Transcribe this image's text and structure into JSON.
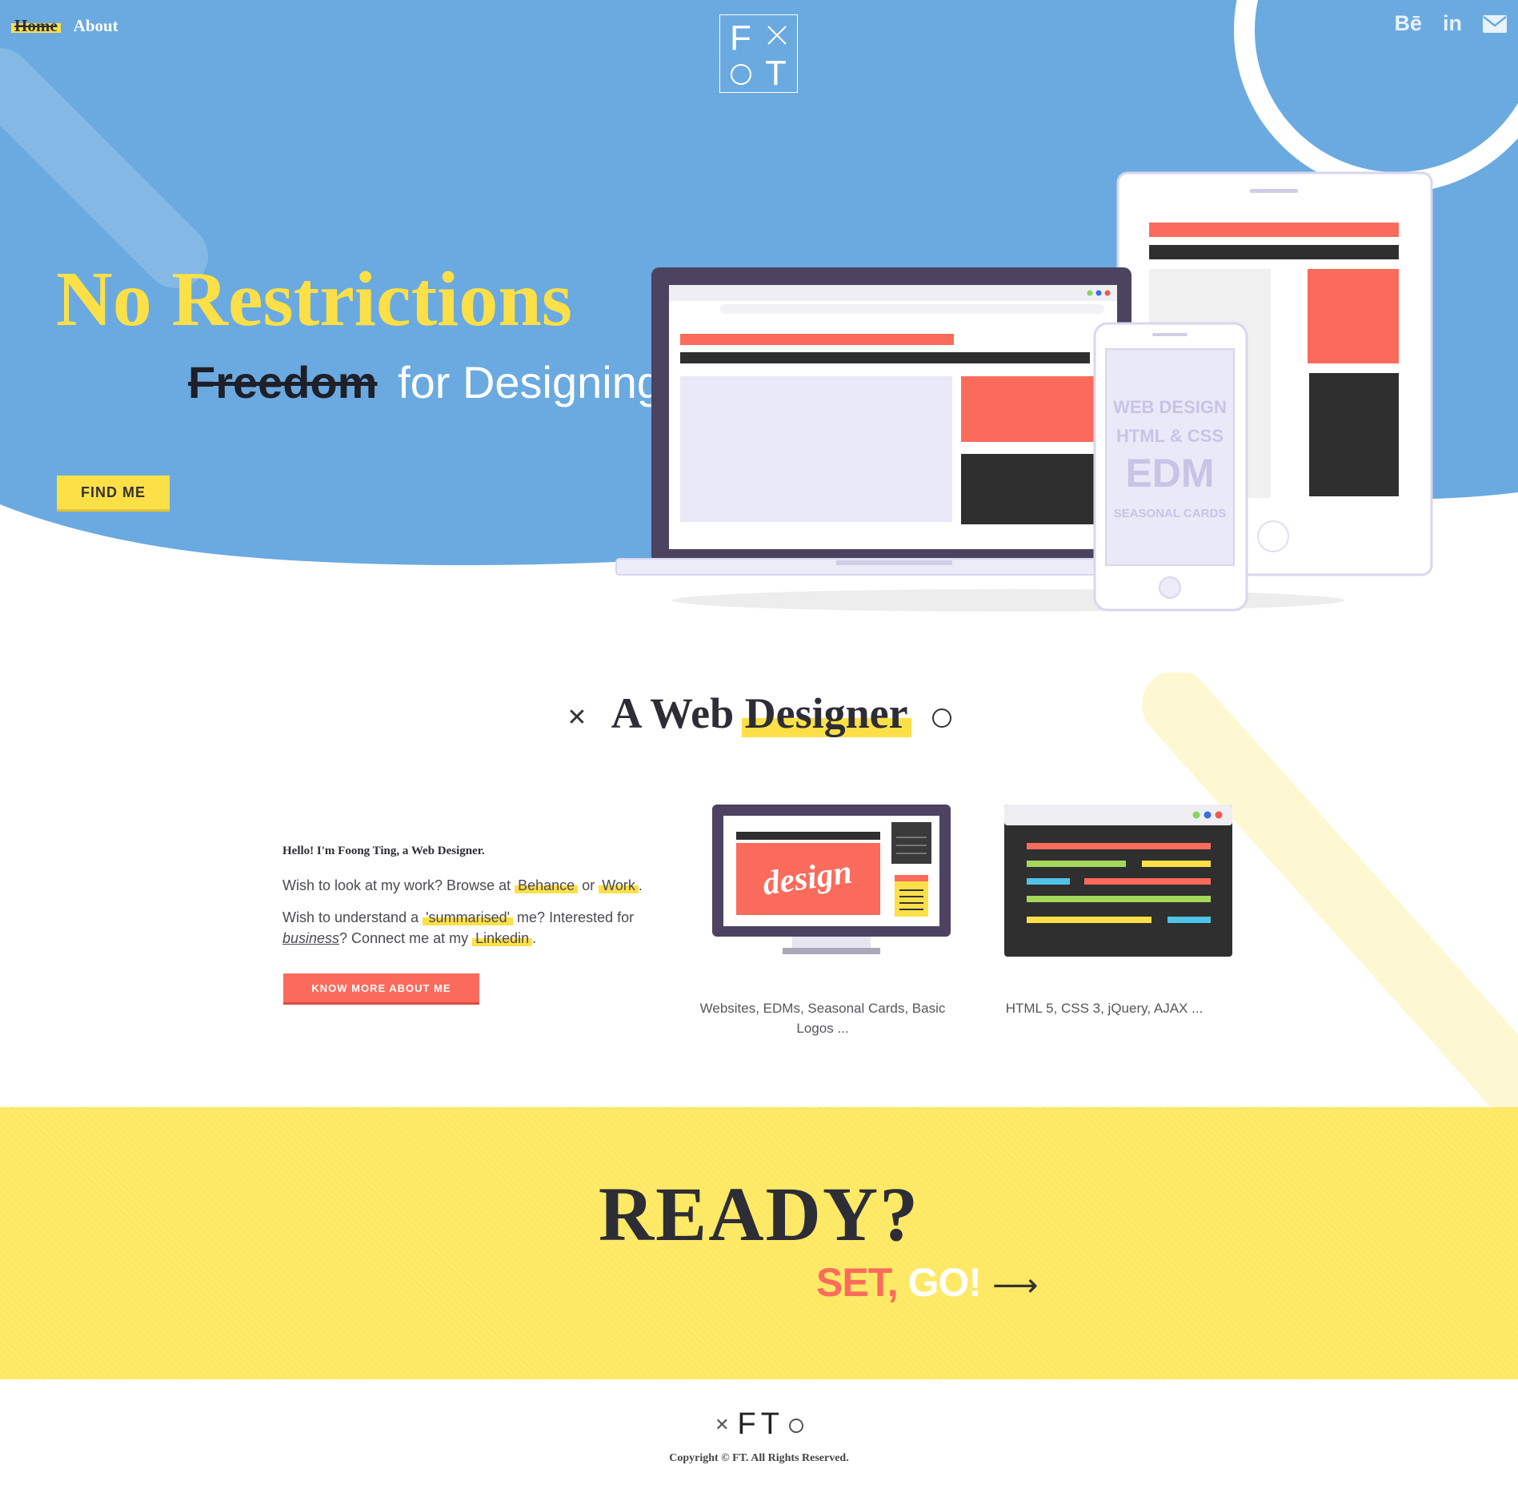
{
  "nav": {
    "home": "Home",
    "about": "About"
  },
  "logo": {
    "f": "F",
    "t": "T"
  },
  "social": {
    "behance": "Bē",
    "linkedin": "in",
    "mail_icon": "mail-icon"
  },
  "hero": {
    "title": "No Restrictions",
    "highlight": "Freedom",
    "subtitle_rest": "for Designing",
    "button": "FIND ME"
  },
  "mockups": {
    "phone_line1": "WEB DESIGN",
    "phone_line2": "HTML & CSS",
    "phone_line3": "EDM",
    "phone_line4": "SEASONAL CARDS",
    "design_word": "design"
  },
  "designer": {
    "title_start": "A Web",
    "title_highlight": "Designer",
    "hello": "Hello! I'm Foong Ting, a Web Designer.",
    "line1_pre": "Wish to look at my work? Browse at",
    "behance": "Behance",
    "or": "or",
    "work": "Work",
    "line1_end": ".",
    "line2_pre": "Wish to understand a",
    "summarised": "'summarised'",
    "line2_mid": "me? Interested for",
    "business": "business",
    "line2_mid2": "? Connect me at my",
    "linkedin": "Linkedin",
    "line2_end": ".",
    "button": "KNOW MORE ABOUT ME",
    "cap1": "Websites, EDMs, Seasonal Cards, Basic Logos ...",
    "cap2": "HTML 5, CSS 3, jQuery, AJAX ..."
  },
  "ready": {
    "title": "READY?",
    "set": "SET,",
    "go": "GO!",
    "arrow": "⟶"
  },
  "footer": {
    "logo": "FT",
    "copyright": "Copyright © FT. All Rights Reserved."
  },
  "colors": {
    "blue": "#6aaae0",
    "yellow": "#fde047",
    "coral": "#fb6b5b",
    "dark": "#2d2d35",
    "purple": "#4c4361"
  }
}
